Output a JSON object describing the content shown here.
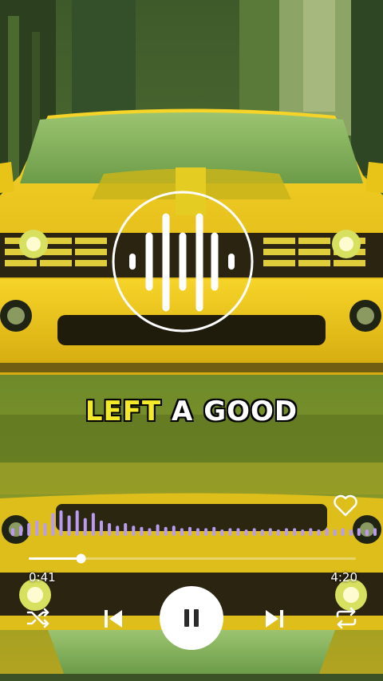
{
  "caption": {
    "word1": "LEFT",
    "word2": "A",
    "word3": "GOOD"
  },
  "player": {
    "current_time": "0:41",
    "total_time": "4:20",
    "progress": 0.16,
    "state": "playing"
  },
  "icons": {
    "badge": "audio-waveform-icon",
    "like": "heart-icon",
    "shuffle": "shuffle-icon",
    "previous": "skip-previous-icon",
    "play_pause": "pause-icon",
    "next": "skip-next-icon",
    "repeat": "repeat-icon"
  },
  "colors": {
    "car_yellow": "#f0cc1c",
    "caption_highlight": "#f4ea2a",
    "spectrum": "#b99cf2",
    "progress": "#ffffff"
  },
  "spectrum_levels": [
    0.3,
    0.4,
    0.5,
    0.6,
    0.5,
    0.9,
    1.0,
    0.8,
    1.0,
    0.7,
    0.9,
    0.6,
    0.5,
    0.4,
    0.5,
    0.4,
    0.35,
    0.3,
    0.45,
    0.35,
    0.4,
    0.3,
    0.35,
    0.3,
    0.3,
    0.35,
    0.25,
    0.3,
    0.3,
    0.25,
    0.3,
    0.25,
    0.3,
    0.25,
    0.3,
    0.3,
    0.25,
    0.3,
    0.25,
    0.3,
    0.25,
    0.3,
    0.25,
    0.3,
    0.25,
    0.3
  ]
}
